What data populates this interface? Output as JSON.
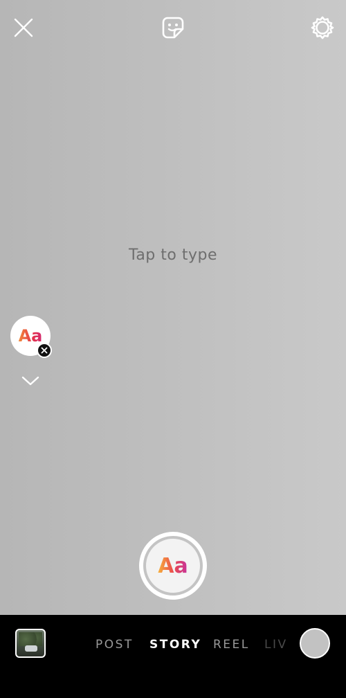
{
  "colors": {
    "canvas": "#bfbfbf",
    "prompt_text": "#6e6e6e",
    "bar": "#000000",
    "active_tab": "#ffffff",
    "inactive_tab": "#9a9a9a"
  },
  "header": {
    "close_icon": "close-icon",
    "sticker_icon": "sticker-icon",
    "settings_icon": "gear-icon"
  },
  "canvas": {
    "prompt": "Tap to type"
  },
  "font_picker": {
    "label": "Aa"
  },
  "shutter": {
    "label": "Aa"
  },
  "mode_tabs": [
    {
      "label": "POST",
      "active": false
    },
    {
      "label": "STORY",
      "active": true
    },
    {
      "label": "REEL",
      "active": false
    },
    {
      "label": "LIV",
      "active": false
    }
  ]
}
